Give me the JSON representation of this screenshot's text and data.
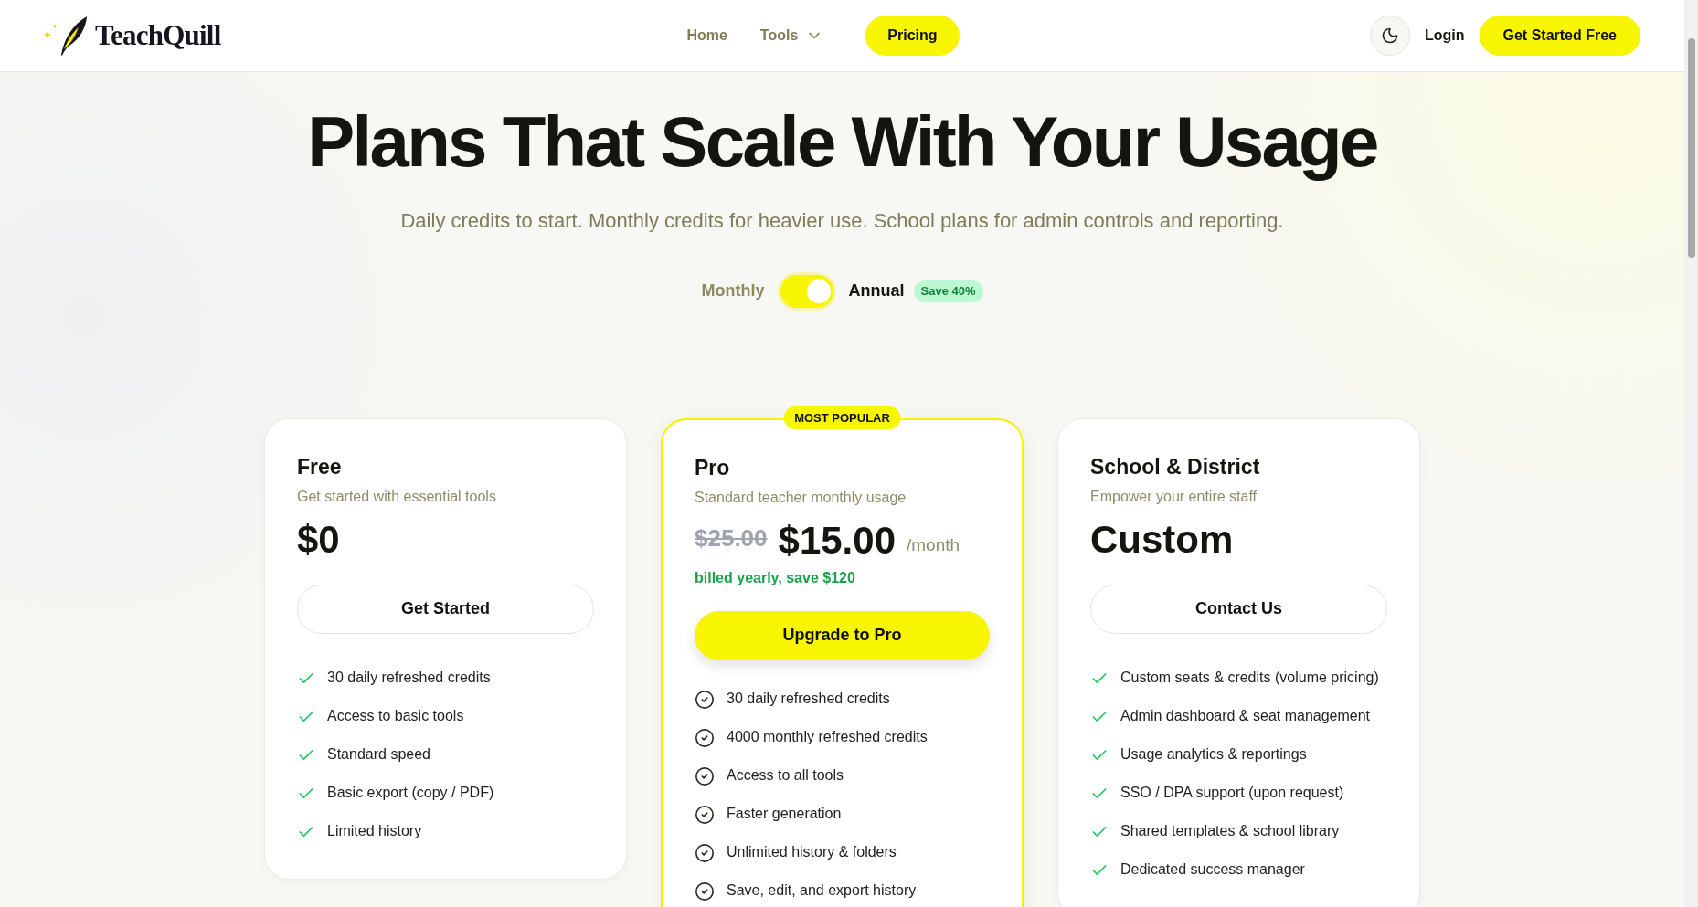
{
  "header": {
    "logo": "TeachQuill",
    "nav": [
      {
        "label": "Home",
        "selected": false,
        "has_menu": false
      },
      {
        "label": "Tools",
        "selected": false,
        "has_menu": true
      },
      {
        "label": "Pricing",
        "selected": true,
        "has_menu": false
      }
    ],
    "login": "Login",
    "cta": "Get Started Free"
  },
  "hero": {
    "title": "Plans That Scale With Your Usage",
    "subtitle": "Daily credits to start. Monthly credits for heavier use. School plans for admin controls and reporting."
  },
  "billing": {
    "monthly_label": "Monthly",
    "annual_label": "Annual",
    "on": true,
    "badge": "Save 40%"
  },
  "plans": [
    {
      "name": "Free",
      "description": "Get started with essential tools",
      "featured": false,
      "price": "$0",
      "button": "Get Started",
      "kind": "check",
      "features": [
        "30 daily refreshed credits",
        "Access to basic tools",
        "Standard speed",
        "Basic export (copy / PDF)",
        "Limited history"
      ]
    },
    {
      "name": "Pro",
      "description": "Standard teacher monthly usage",
      "featured": true,
      "ribbon": "MOST POPULAR",
      "old_price": "$25.00",
      "price": "$15.00",
      "period": "/month",
      "note": "billed yearly, save $120",
      "button": "Upgrade to Pro",
      "kind": "circle-check",
      "features": [
        "30 daily refreshed credits",
        "4000 monthly refreshed credits",
        "Access to all tools",
        "Faster generation",
        "Unlimited history & folders",
        "Save, edit, and export history"
      ]
    },
    {
      "name": "School & District",
      "description": "Empower your entire staff",
      "featured": false,
      "price": "Custom",
      "button": "Contact Us",
      "kind": "check",
      "features": [
        "Custom seats & credits (volume pricing)",
        "Admin dashboard & seat management",
        "Usage analytics & reportings",
        "SSO / DPA support (upon request)",
        "Shared templates & school library",
        "Dedicated success manager"
      ]
    }
  ]
}
